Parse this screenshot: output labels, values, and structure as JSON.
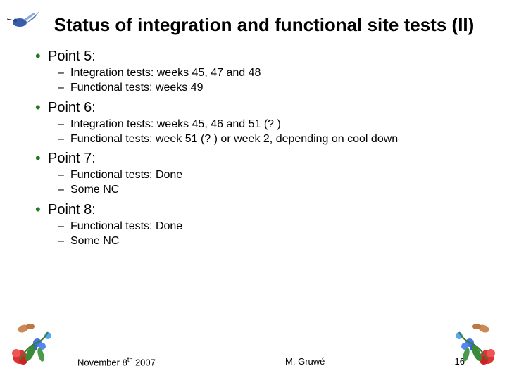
{
  "title": "Status of integration and functional site tests (II)",
  "points": [
    {
      "label": "Point 5:",
      "subs": [
        "Integration tests: weeks 45, 47 and 48",
        "Functional tests: weeks 49"
      ]
    },
    {
      "label": "Point 6:",
      "subs": [
        "Integration tests: weeks 45, 46 and 51 (? )",
        "Functional tests: week 51 (? ) or week 2, depending on cool down"
      ]
    },
    {
      "label": "Point 7:",
      "subs": [
        "Functional tests: Done",
        "Some NC"
      ]
    },
    {
      "label": "Point 8:",
      "subs": [
        "Functional tests: Done",
        "Some NC"
      ]
    }
  ],
  "footer": {
    "date_prefix": "November 8",
    "date_suffix": "th",
    "date_year": " 2007",
    "author": "M. Gruwé",
    "page": "16"
  }
}
